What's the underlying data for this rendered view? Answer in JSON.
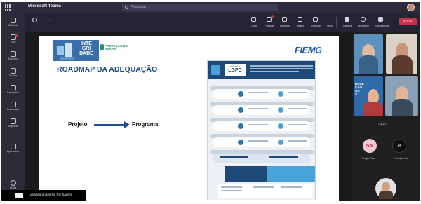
{
  "titlebar": {
    "app_name": "Microsoft Teams",
    "search_placeholder": "Pesquisar",
    "more": "···"
  },
  "rail": {
    "items": [
      {
        "label": "Atividade",
        "icon": "bell-icon"
      },
      {
        "label": "Chat",
        "icon": "chat-icon",
        "badge": true
      },
      {
        "label": "Equipes",
        "icon": "teams-icon"
      },
      {
        "label": "Tarefas",
        "icon": "tasks-icon"
      },
      {
        "label": "Calendário",
        "icon": "calendar-icon"
      },
      {
        "label": "Chamadas",
        "icon": "phone-icon"
      },
      {
        "label": "Arquivos",
        "icon": "files-icon"
      },
      {
        "label": "Aplicativos",
        "icon": "apps-icon"
      },
      {
        "label": "Ajuda",
        "icon": "help-icon"
      }
    ]
  },
  "meeting_toolbar": {
    "dots": "···",
    "items": [
      {
        "label": "Chat",
        "icon": "chat-icon"
      },
      {
        "label": "Pessoas",
        "icon": "people-icon"
      },
      {
        "label": "Levantar",
        "icon": "raise-hand-icon"
      },
      {
        "label": "Reagir",
        "icon": "react-icon"
      },
      {
        "label": "Exibição",
        "icon": "view-icon"
      },
      {
        "label": "Mais",
        "icon": "more-icon"
      },
      {
        "label": "Câmera",
        "icon": "camera-icon"
      },
      {
        "label": "Microfone",
        "icon": "mic-icon"
      },
      {
        "label": "Compartilhar",
        "icon": "share-icon"
      }
    ],
    "leave_label": "Sair"
  },
  "slide": {
    "logo_text": "INTE GRI DADE",
    "protecao": "PROTEÇÃO DE DADOS",
    "fiemg": "FIEMG",
    "title": "ROADMAP DA ADEQUAÇÃO",
    "left_word": "Projeto",
    "right_word": "Programa",
    "infographic": {
      "header_small": "PROJETO",
      "header_big": "LGPD"
    }
  },
  "roster": {
    "overlay_text": "DADE\nÇÃO\nOS\nS",
    "pager": "1/2",
    "sn_initials": "SN",
    "sn_name": "Sergio Rezz...",
    "participants_count": "14",
    "participants_label": "Participantes"
  },
  "bottombar": {
    "text": "Lima Marangon Da Rin Saurea"
  },
  "colors": {
    "teams_dark": "#2d2c3f",
    "leave_red": "#c4314b",
    "slide_blue": "#1f4e8c",
    "fiemg_blue": "#1d5aa6"
  }
}
